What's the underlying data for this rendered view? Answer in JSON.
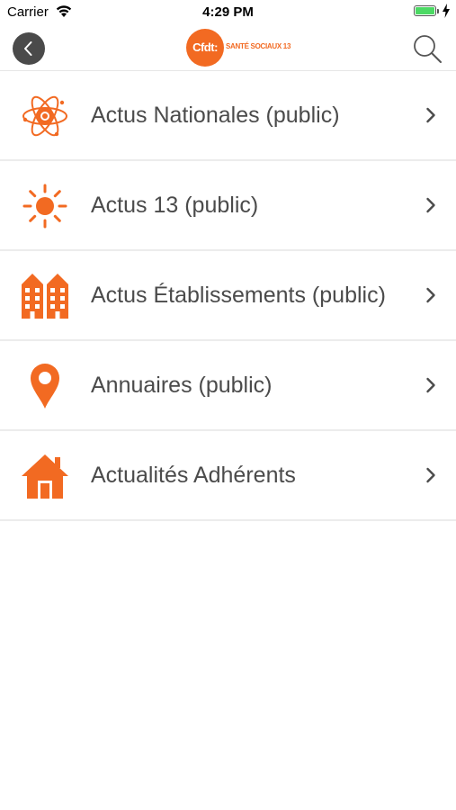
{
  "status_bar": {
    "carrier": "Carrier",
    "time": "4:29 PM",
    "battery_level": 1.0,
    "charging": true
  },
  "nav": {
    "back_icon": "chevron-left-icon",
    "logo": {
      "badge_text": "Cfdt:",
      "subtitle": "SANTÉ SOCIAUX 13"
    },
    "search_icon": "search-icon"
  },
  "menu": {
    "items": [
      {
        "label": "Actus Nationales (public)",
        "icon": "atom-icon"
      },
      {
        "label": "Actus 13 (public)",
        "icon": "sun-icon"
      },
      {
        "label": "Actus Établissements (public)",
        "icon": "buildings-icon"
      },
      {
        "label": "Annuaires (public)",
        "icon": "map-pin-icon"
      },
      {
        "label": "Actualités Adhérents",
        "icon": "house-icon"
      }
    ]
  },
  "colors": {
    "accent": "#f26a22",
    "text": "#4b4b4b",
    "divider": "#ececec",
    "back_button_bg": "#4a4a4a",
    "battery": "#4cd964"
  }
}
